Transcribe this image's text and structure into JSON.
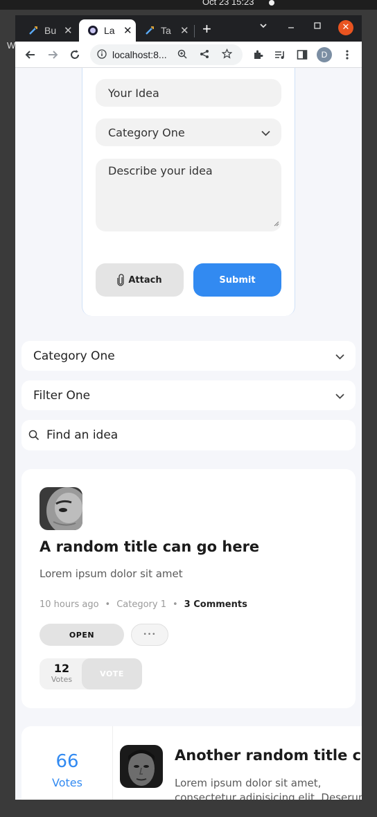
{
  "os": {
    "clock": "Oct 23  15:23",
    "desktop_letter": "W"
  },
  "browser": {
    "tabs": [
      {
        "label": "Bu",
        "close": "✕"
      },
      {
        "label": "La",
        "close": "✕"
      },
      {
        "label": "Ta",
        "close": "✕"
      }
    ],
    "new_tab": "+",
    "url": "localhost:8...",
    "profile_initial": "D",
    "win_close": "✕"
  },
  "form": {
    "title_placeholder": "Your Idea",
    "category_selected": "Category One",
    "description_placeholder": "Describe your idea",
    "attach_label": "Attach",
    "submit_label": "Submit"
  },
  "filters": {
    "category": "Category One",
    "filter": "Filter One",
    "search_placeholder": "Find an idea"
  },
  "ideas": [
    {
      "title": "A random title can go here",
      "description": "Lorem ipsum dolor sit amet",
      "time": "10 hours ago",
      "dot": "•",
      "category": "Category 1",
      "comments": "3 Comments",
      "status": "OPEN",
      "more": "•••",
      "votes": "12",
      "votes_label": "Votes",
      "vote_button": "VOTE"
    },
    {
      "title": "Another random title can go here",
      "description": "Lorem ipsum dolor sit amet, consectetur adipisicing elit. Deserunt dolores dolorum enim molestias quibusdam. Excepturi explicabo nihil ducimus",
      "votes": "66",
      "votes_label": "Votes"
    }
  ],
  "colors": {
    "accent": "#328af1",
    "os_close": "#e95420"
  }
}
